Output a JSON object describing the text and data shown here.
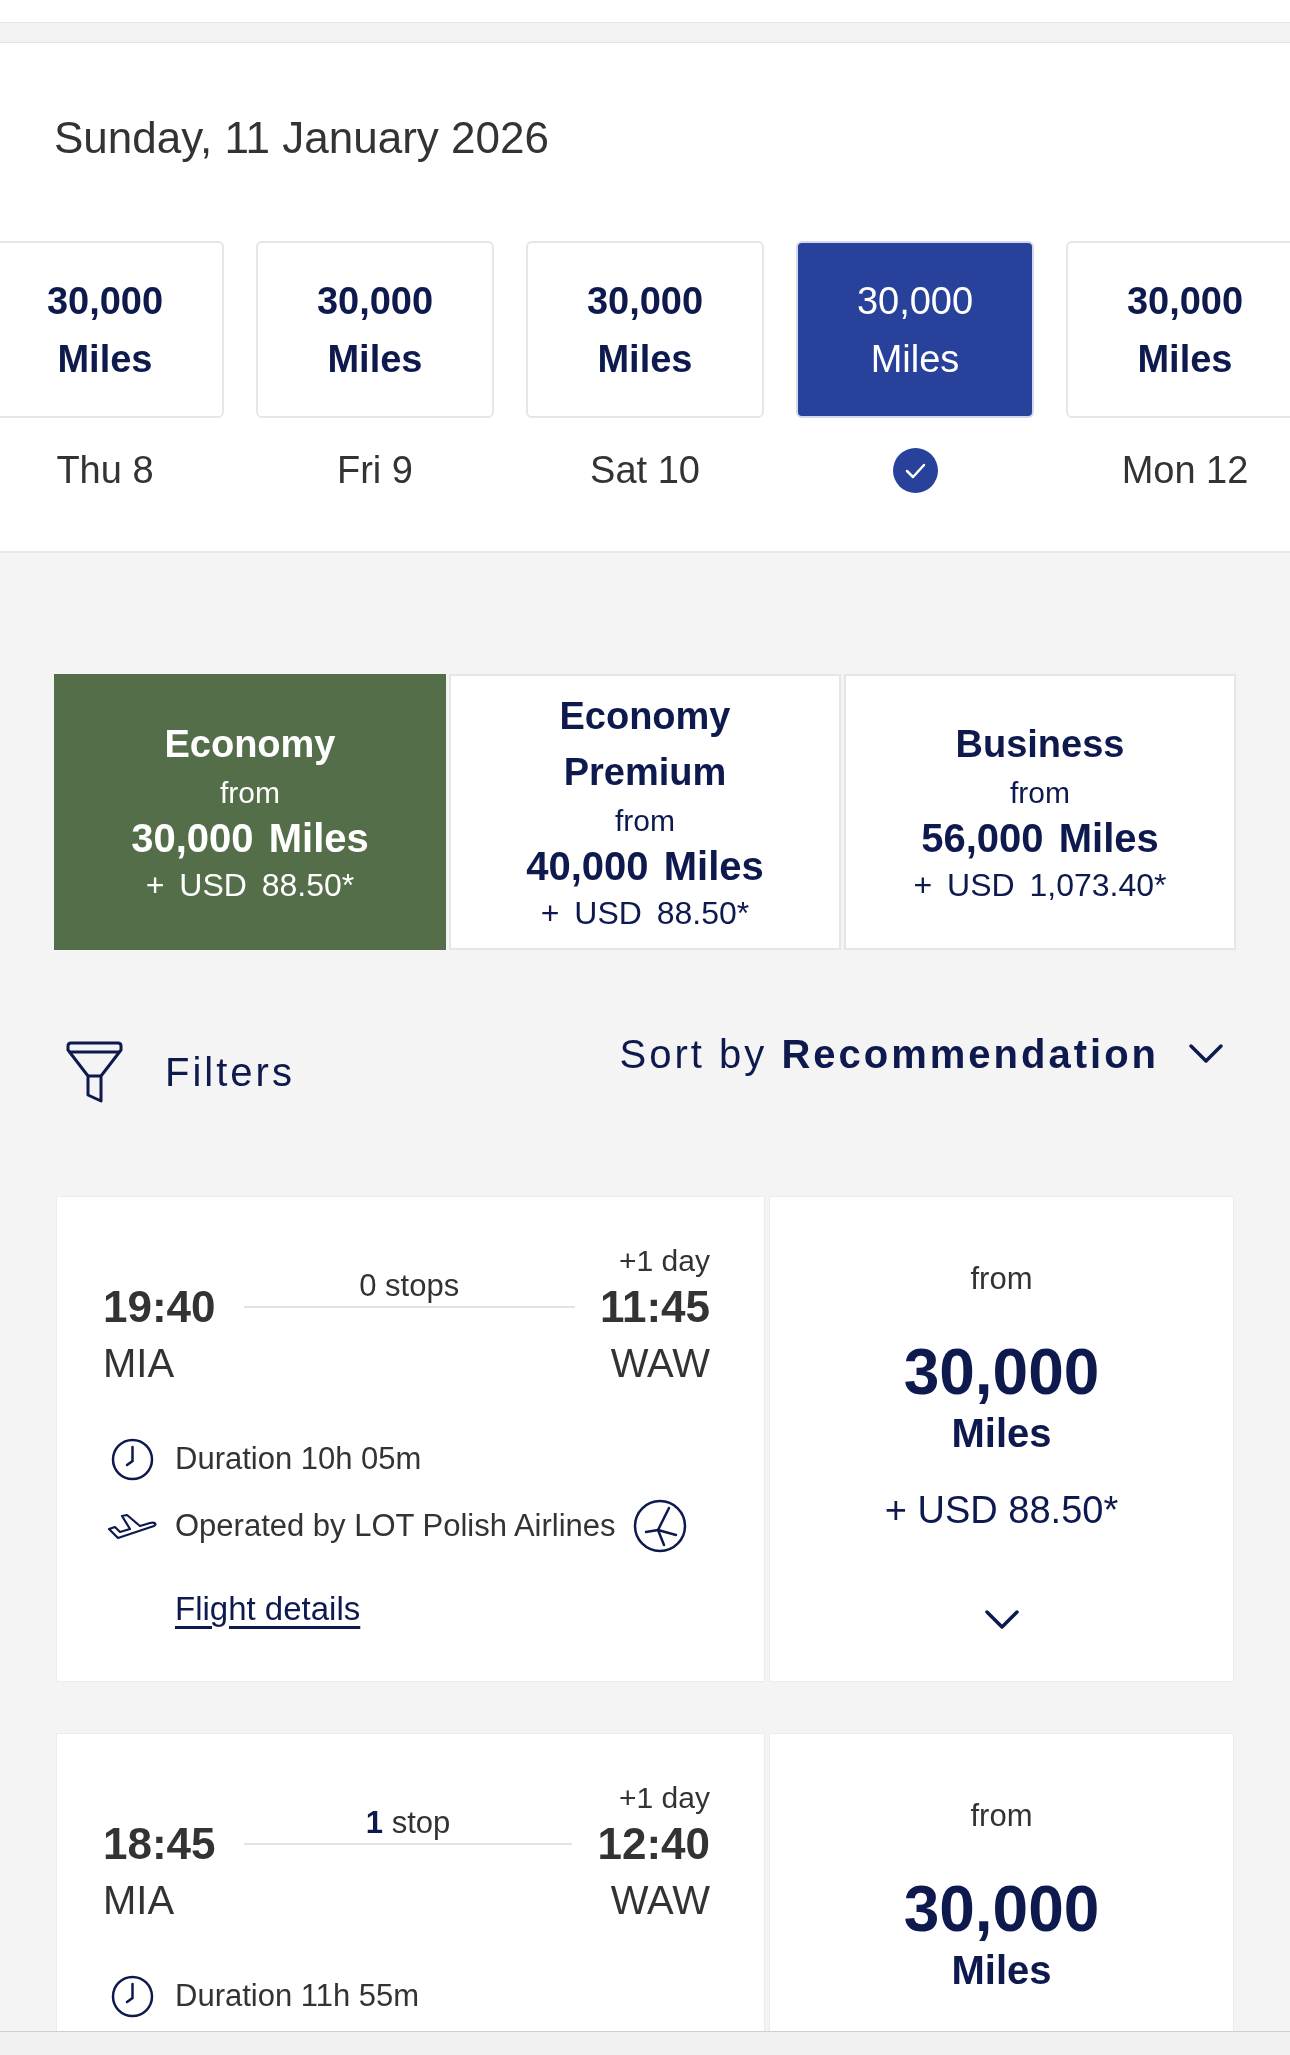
{
  "top": {
    "date_title": "Sunday, 11 January 2026"
  },
  "date_tabs": [
    {
      "miles": "30,000",
      "unit": "Miles",
      "day": "Thu 8",
      "selected": false
    },
    {
      "miles": "30,000",
      "unit": "Miles",
      "day": "Fri 9",
      "selected": false
    },
    {
      "miles": "30,000",
      "unit": "Miles",
      "day": "Sat 10",
      "selected": false
    },
    {
      "miles": "30,000",
      "unit": "Miles",
      "selected": true
    },
    {
      "miles": "30,000",
      "unit": "Miles",
      "day": "Mon 12",
      "selected": false
    }
  ],
  "cabins": [
    {
      "name": "Economy",
      "from": "from",
      "miles": "30,000 Miles",
      "price": "+ USD 88.50*",
      "selected": true
    },
    {
      "name": "Economy Premium",
      "from": "from",
      "miles": "40,000 Miles",
      "price": "+ USD 88.50*",
      "selected": false
    },
    {
      "name": "Business",
      "from": "from",
      "miles": "56,000 Miles",
      "price": "+ USD 1,073.40*",
      "selected": false
    }
  ],
  "filters": {
    "label": "Filters"
  },
  "sort": {
    "label": "Sort by",
    "value": "Recommendation"
  },
  "flights": [
    {
      "departure_time": "19:40",
      "departure_airport": "MIA",
      "stops": "0 stops",
      "day_offset": "+1 day",
      "arrival_time": "11:45",
      "arrival_airport": "WAW",
      "duration": "Duration 10h 05m",
      "operator": "Operated by LOT Polish Airlines",
      "details_link": "Flight details",
      "fare": {
        "from": "from",
        "miles": "30,000",
        "unit": "Miles",
        "price": "+ USD 88.50*",
        "expanded": false
      }
    },
    {
      "departure_time": "18:45",
      "departure_airport": "MIA",
      "stops": "**1** stop",
      "day_offset": "+1 day",
      "arrival_time": "12:40",
      "arrival_airport": "WAW",
      "duration": "Duration 11h 55m",
      "fare": {
        "from": "from",
        "miles": "30,000",
        "unit": "Miles"
      }
    }
  ]
}
